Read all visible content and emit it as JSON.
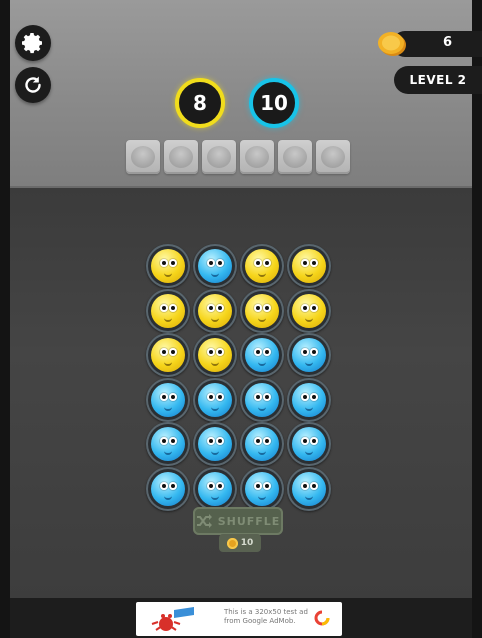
{
  "hud": {
    "coins": "6",
    "level": "LEVEL 2",
    "coin_icon": "coin-icon",
    "settings_icon": "gear-icon",
    "restart_icon": "restart-icon"
  },
  "goals": [
    {
      "color": "yellow",
      "count": "8",
      "hex": "#f1dd1c"
    },
    {
      "color": "blue",
      "count": "10",
      "hex": "#18c3e8"
    }
  ],
  "tray": {
    "slots": 6
  },
  "grid": {
    "rows": [
      [
        "yellow",
        "blue",
        "yellow",
        "yellow"
      ],
      [
        "yellow",
        "yellow",
        "yellow",
        "yellow"
      ],
      [
        "yellow",
        "yellow",
        "blue",
        "blue"
      ],
      [
        "blue",
        "blue",
        "blue",
        "blue"
      ],
      [
        "blue",
        "blue",
        "blue",
        "blue"
      ],
      [
        "blue",
        "blue",
        "blue",
        "blue"
      ]
    ]
  },
  "shuffle": {
    "label": "SHUFFLE",
    "cost": "10",
    "icon": "shuffle-icon"
  },
  "ad": {
    "line1": "This is a 320x50 test ad",
    "line2": "from Google AdMob."
  },
  "colors": {
    "yellow": "#f6d51a",
    "blue": "#34b8f0",
    "accent_yellow": "#f1dd1c",
    "accent_blue": "#18c3e8"
  }
}
